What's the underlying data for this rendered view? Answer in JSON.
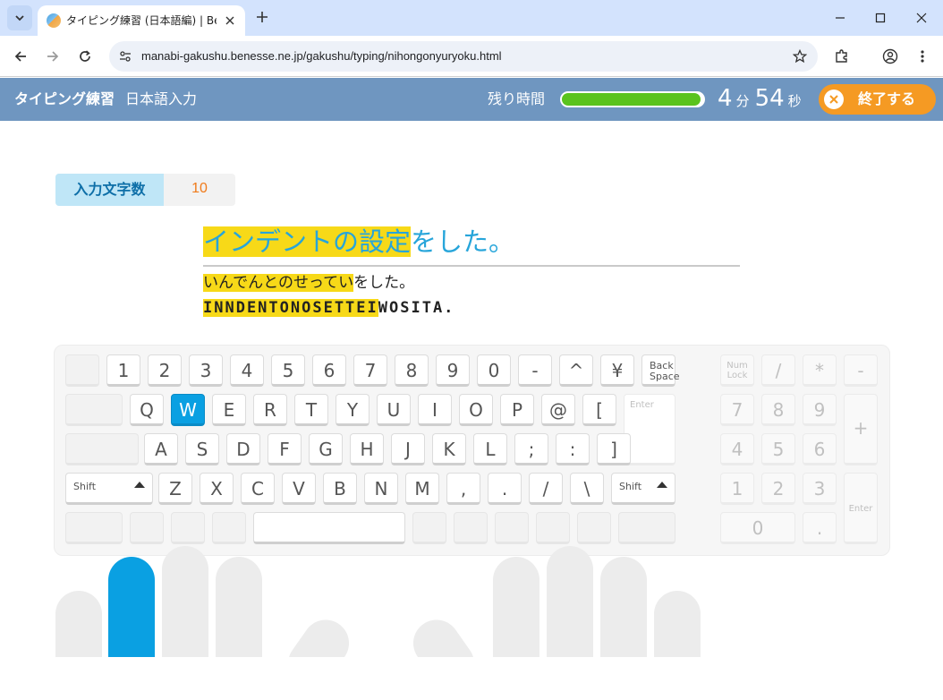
{
  "browser": {
    "tab_title": "タイピング練習 (日本語編) | Bene",
    "url": "manabi-gakushu.benesse.ne.jp/gakushu/typing/nihongonyuryoku.html"
  },
  "header": {
    "title": "タイピング練習",
    "subtitle": "日本語入力",
    "time_label": "残り時間",
    "time_remaining_fraction": 0.98,
    "minutes": "4",
    "minutes_unit": "分",
    "seconds": "54",
    "seconds_unit": "秒",
    "end_button": "終了する"
  },
  "counter": {
    "label": "入力文字数",
    "value": "10"
  },
  "exercise": {
    "sentence_done": "インデントの設定",
    "sentence_rest": "をした。",
    "reading_done": "いんでんとのせってい",
    "reading_rest": "をした。",
    "romaji_done": "INNDENTONOSETTEI",
    "romaji_rest": "WOSITA."
  },
  "keyboard": {
    "row1": [
      "1",
      "2",
      "3",
      "4",
      "5",
      "6",
      "7",
      "8",
      "9",
      "0",
      "-",
      "^",
      "¥"
    ],
    "backspace": "Back Space",
    "row2": [
      "Q",
      "W",
      "E",
      "R",
      "T",
      "Y",
      "U",
      "I",
      "O",
      "P",
      "@",
      "["
    ],
    "enter": "Enter",
    "row3": [
      "A",
      "S",
      "D",
      "F",
      "G",
      "H",
      "J",
      "K",
      "L",
      ";",
      ":",
      "]"
    ],
    "shift": "Shift",
    "row4": [
      "Z",
      "X",
      "C",
      "V",
      "B",
      "N",
      "M",
      ",",
      ".",
      "/",
      "\\"
    ],
    "active_key": "W",
    "numpad": {
      "numlock": "Num Lock",
      "row1": [
        "/",
        "*",
        "-"
      ],
      "row2": [
        "7",
        "8",
        "9"
      ],
      "plus": "+",
      "row3": [
        "4",
        "5",
        "6"
      ],
      "row4": [
        "1",
        "2",
        "3"
      ],
      "enter": "Enter",
      "zero": "0",
      "dot": "."
    }
  },
  "colors": {
    "accent_blue": "#0aa0e2",
    "highlight_yellow": "#f7d918",
    "header_bg": "#6f96c0",
    "end_button_orange": "#f59a23",
    "timer_green": "#5ac31e"
  }
}
